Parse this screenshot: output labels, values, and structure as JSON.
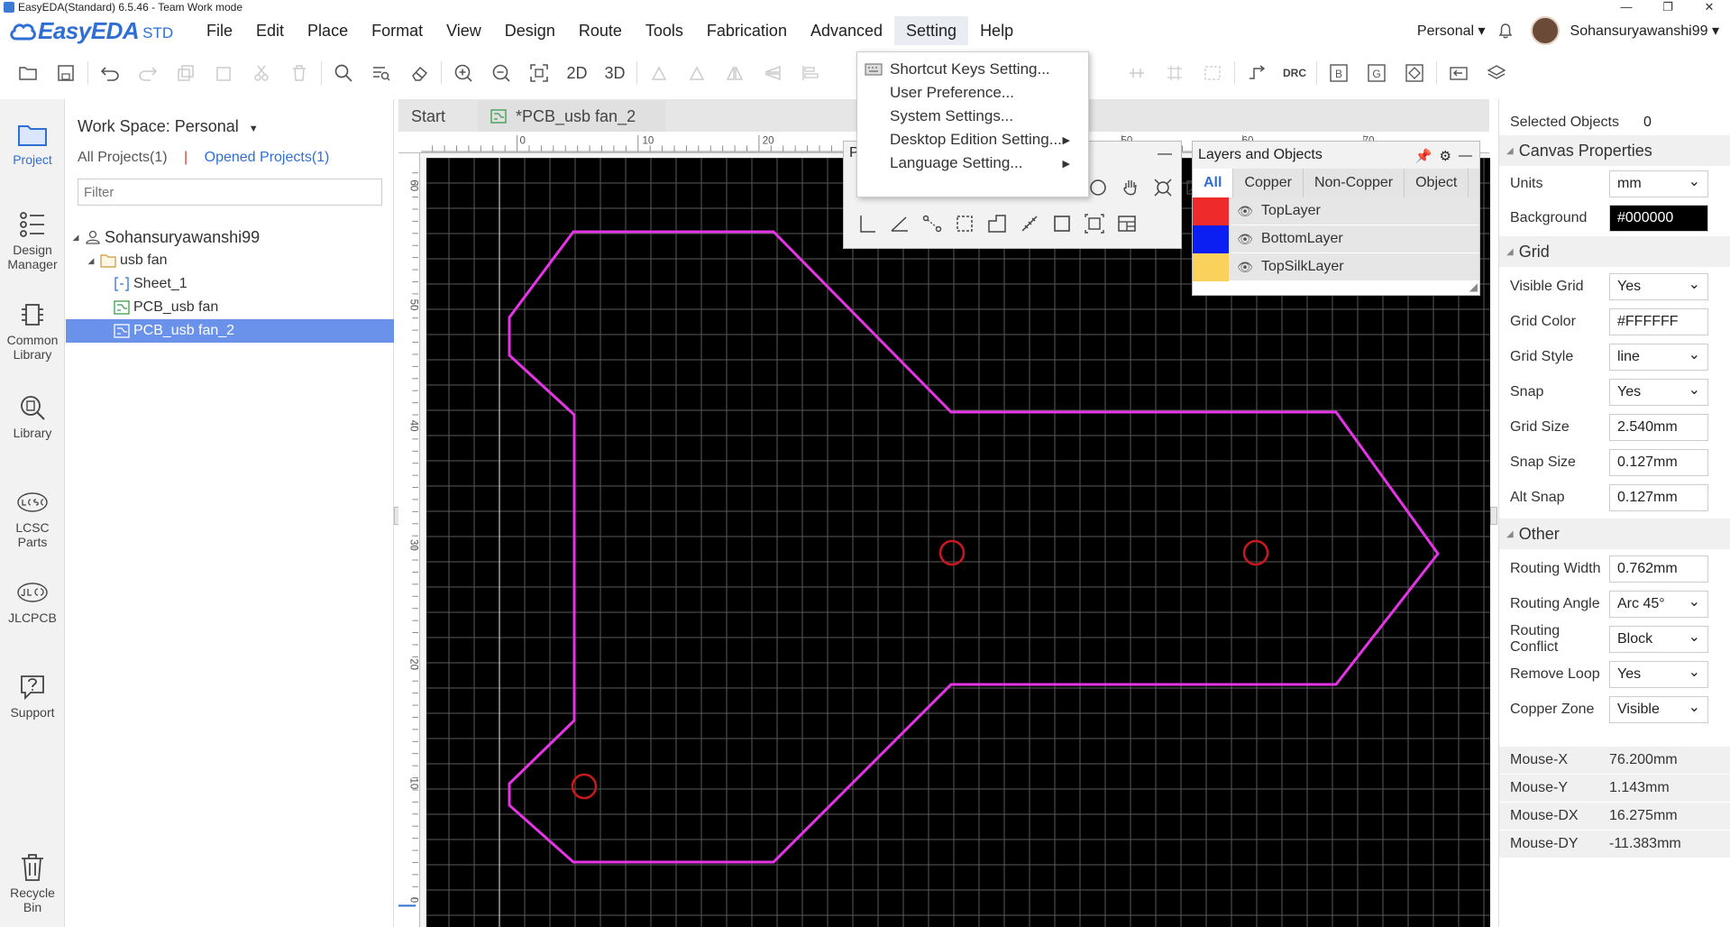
{
  "window": {
    "title": "EasyEDA(Standard) 6.5.46 - Team Work mode",
    "controls": [
      "—",
      "❐",
      "✕"
    ]
  },
  "brand": {
    "name": "EasyEDA",
    "edition": "STD"
  },
  "menu": [
    "File",
    "Edit",
    "Place",
    "Format",
    "View",
    "Design",
    "Route",
    "Tools",
    "Fabrication",
    "Advanced",
    "Setting",
    "Help"
  ],
  "header_right": {
    "workspace": "Personal ▾",
    "username": "Sohansuryawanshi99 ▾"
  },
  "toolbar": {
    "view_2d": "2D",
    "view_3d": "3D",
    "drc": "DRC",
    "b_label": "B",
    "g_label": "G"
  },
  "leftnav": [
    {
      "label": "Project"
    },
    {
      "label": "Design Manager"
    },
    {
      "label": "Common Library"
    },
    {
      "label": "Library"
    },
    {
      "label": "LCSC Parts"
    },
    {
      "label": "JLCPCB"
    },
    {
      "label": "Support"
    },
    {
      "label": "Recycle Bin"
    }
  ],
  "project_panel": {
    "workspace_title": "Work Space: Personal",
    "all_projects": "All Projects(1)",
    "separator": "|",
    "opened_projects": "Opened Projects(1)",
    "filter_placeholder": "Filter",
    "tree": [
      {
        "label": "Sohansuryawanshi99",
        "level": 0
      },
      {
        "label": "usb fan",
        "level": 1
      },
      {
        "label": "Sheet_1",
        "level": 2
      },
      {
        "label": "PCB_usb fan",
        "level": 2
      },
      {
        "label": "PCB_usb fan_2",
        "level": 2,
        "selected": true
      }
    ]
  },
  "tabs": [
    {
      "label": "Start"
    },
    {
      "label": "*PCB_usb fan_2",
      "active": true
    }
  ],
  "setting_menu": [
    {
      "label": "Shortcut Keys Setting..."
    },
    {
      "label": "User Preference..."
    },
    {
      "label": "System Settings..."
    },
    {
      "label": "Desktop Edition Setting..."
    },
    {
      "label": "Language Setting..."
    }
  ],
  "tools_panel": {
    "title": "P"
  },
  "layers_panel": {
    "title": "Layers and Objects",
    "tabs": [
      "All",
      "Copper",
      "Non-Copper",
      "Object"
    ],
    "layers": [
      {
        "name": "TopLayer",
        "color": "#EE2A2A"
      },
      {
        "name": "BottomLayer",
        "color": "#0C1FF2"
      },
      {
        "name": "TopSilkLayer",
        "color": "#FAD25B"
      }
    ]
  },
  "ruler": {
    "top": [
      "0",
      "10",
      "20",
      "50",
      "60",
      "70"
    ],
    "left": [
      "60",
      "50",
      "40",
      "30",
      "20",
      "10",
      "0"
    ]
  },
  "properties": {
    "selected_label": "Selected Objects",
    "selected_count": "0",
    "canvas_section": "Canvas Properties",
    "units_label": "Units",
    "units": "mm",
    "background_label": "Background",
    "background": "#000000",
    "grid_section": "Grid",
    "visible_grid_label": "Visible Grid",
    "visible_grid": "Yes",
    "grid_color_label": "Grid Color",
    "grid_color": "#FFFFFF",
    "grid_style_label": "Grid Style",
    "grid_style": "line",
    "snap_label": "Snap",
    "snap": "Yes",
    "grid_size_label": "Grid Size",
    "grid_size": "2.540mm",
    "snap_size_label": "Snap Size",
    "snap_size": "0.127mm",
    "alt_snap_label": "Alt Snap",
    "alt_snap": "0.127mm",
    "other_section": "Other",
    "routing_width_label": "Routing Width",
    "routing_width": "0.762mm",
    "routing_angle_label": "Routing Angle",
    "routing_angle": "Arc 45°",
    "routing_conflict_label": "Routing Conflict",
    "routing_conflict": "Block",
    "remove_loop_label": "Remove Loop",
    "remove_loop": "Yes",
    "copper_zone_label": "Copper Zone",
    "copper_zone": "Visible"
  },
  "mouse": [
    {
      "label": "Mouse-X",
      "value": "76.200mm"
    },
    {
      "label": "Mouse-Y",
      "value": "1.143mm"
    },
    {
      "label": "Mouse-DX",
      "value": "16.275mm"
    },
    {
      "label": "Mouse-DY",
      "value": "-11.383mm"
    }
  ],
  "colors": {
    "accent": "#2F6FD4",
    "outline": "#E534E5",
    "hole": "#C8191F",
    "selection": "#6A92EA"
  }
}
